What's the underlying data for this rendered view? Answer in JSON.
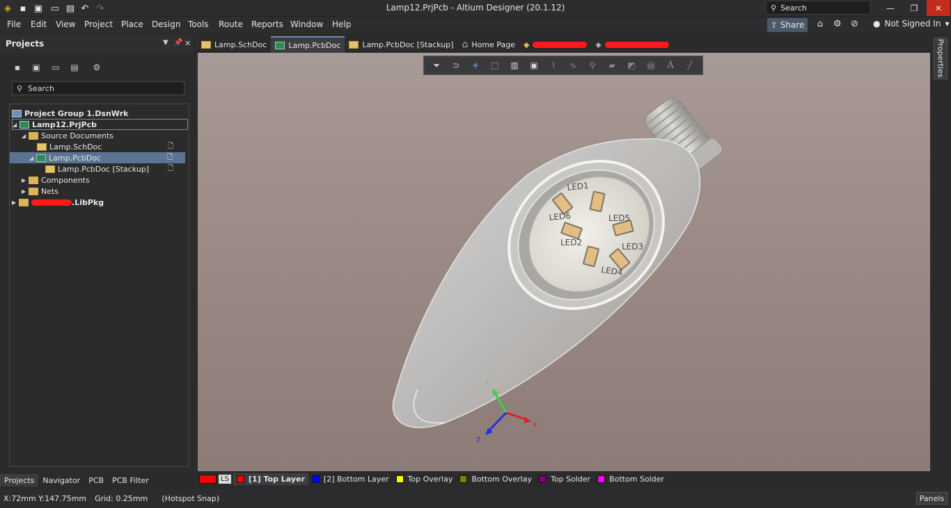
{
  "window": {
    "title": "Lamp12.PrjPcb - Altium Designer (20.1.12)",
    "search_label": "Search"
  },
  "menu": [
    "File",
    "Edit",
    "View",
    "Project",
    "Place",
    "Design",
    "Tools",
    "Route",
    "Reports",
    "Window",
    "Help"
  ],
  "header": {
    "share_label": "Share",
    "account_label": "Not Signed In"
  },
  "projects_panel": {
    "title": "Projects",
    "search_placeholder": "Search",
    "tree": [
      {
        "label": "Project Group 1.DsnWrk",
        "icon": "workspace-icon"
      },
      {
        "label": "Lamp12.PrjPcb",
        "icon": "pcb-project-icon"
      },
      {
        "label": "Source Documents",
        "icon": "folder-icon"
      },
      {
        "label": "Lamp.SchDoc",
        "icon": "schematic-icon"
      },
      {
        "label": "Lamp.PcbDoc",
        "icon": "pcb-doc-icon"
      },
      {
        "label": "Lamp.PcbDoc [Stackup]",
        "icon": "stackup-icon"
      },
      {
        "label": "Components",
        "icon": "folder-icon"
      },
      {
        "label": "Nets",
        "icon": "folder-icon"
      },
      {
        "label": ".LibPkg",
        "icon": "library-package-icon"
      }
    ],
    "tabs": [
      "Projects",
      "Navigator",
      "PCB",
      "PCB Filter"
    ]
  },
  "doc_tabs": [
    "Lamp.SchDoc",
    "Lamp.PcbDoc",
    "Lamp.PcbDoc [Stackup]",
    "Home Page"
  ],
  "pcb_labels": [
    "LED1",
    "LED6",
    "LED5",
    "LED2",
    "LED3",
    "LED4"
  ],
  "axes": {
    "x": "X",
    "y": "Y",
    "z": "Z"
  },
  "properties_label": "Properties",
  "layer_bar": {
    "ls_label": "LS",
    "layers": [
      {
        "label": "[1] Top Layer",
        "color": "#ff0000"
      },
      {
        "label": "[2] Bottom Layer",
        "color": "#0000ff"
      },
      {
        "label": "Top Overlay",
        "color": "#ffff00"
      },
      {
        "label": "Bottom Overlay",
        "color": "#808000"
      },
      {
        "label": "Top Solder",
        "color": "#800080"
      },
      {
        "label": "Bottom Solder",
        "color": "#ff00ff"
      }
    ]
  },
  "status": {
    "coords": "X:72mm Y:147.75mm",
    "grid": "Grid: 0.25mm",
    "snap": "(Hotspot Snap)",
    "panels_label": "Panels"
  }
}
